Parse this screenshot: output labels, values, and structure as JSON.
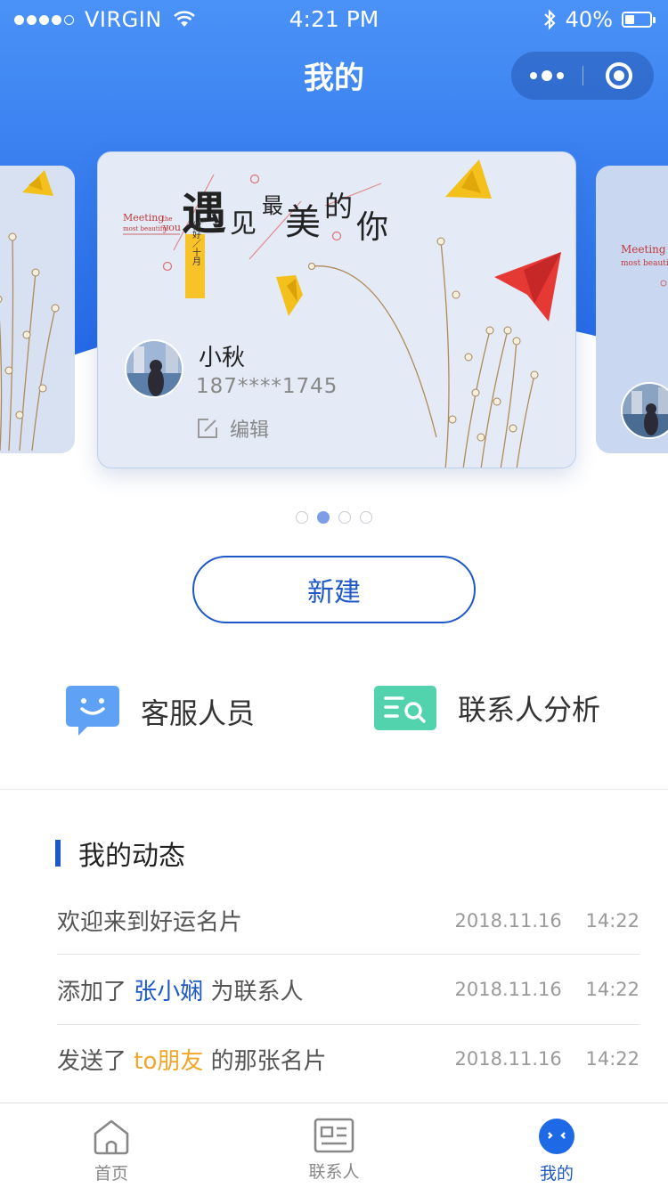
{
  "status_bar": {
    "carrier": "VIRGIN",
    "time": "4:21 PM",
    "battery": "40%",
    "battery_level": 0.4
  },
  "nav": {
    "title": "我的"
  },
  "card": {
    "name": "小秋",
    "phone": "187****1745",
    "edit_label": "编辑",
    "headline_large": "遇",
    "headline_small_1": "见",
    "headline_small_2": "最",
    "headline_large_2": "美",
    "headline_small_3": "的",
    "headline_large_3": "你",
    "tag_en_1": "Meeting",
    "tag_en_2": "the",
    "tag_en_3": "most beautiful",
    "tag_en_4": "you",
    "ribbon": "你好／十月"
  },
  "pager": {
    "count": 4,
    "active_index": 1
  },
  "actions": {
    "new_label": "新建"
  },
  "quick_links": {
    "service_label": "客服人员",
    "analysis_label": "联系人分析"
  },
  "activity": {
    "title": "我的动态",
    "items": [
      {
        "prefix": "欢迎来到好运名片",
        "highlight": "",
        "suffix": "",
        "time": "2018.11.16    14:22"
      },
      {
        "prefix": "添加了 ",
        "highlight": "张小娴",
        "suffix": " 为联系人",
        "time": "2018.11.16    14:22"
      },
      {
        "prefix": "发送了 ",
        "highlight": "to朋友",
        "suffix": " 的那张名片",
        "time": "2018.11.16    14:22"
      }
    ]
  },
  "tab_bar": {
    "home": "首页",
    "contacts": "联系人",
    "mine": "我的"
  },
  "colors": {
    "brand_blue": "#1e58c8",
    "header_gradient_start": "#4a8ef5",
    "header_gradient_end": "#2368e6",
    "highlight_orange": "#f2a62a",
    "analysis_green": "#52d2ad",
    "service_blue": "#5fa2f5"
  }
}
